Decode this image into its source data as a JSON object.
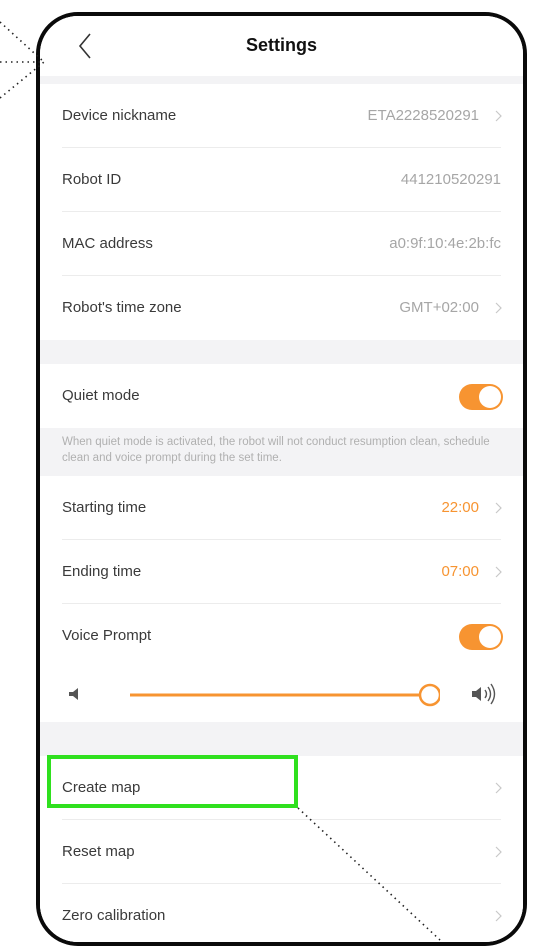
{
  "header": {
    "title": "Settings"
  },
  "device_info": [
    {
      "label": "Device nickname",
      "value": "ETA2228520291",
      "has_chevron": true
    },
    {
      "label": "Robot ID",
      "value": "441210520291",
      "has_chevron": false
    },
    {
      "label": "MAC address",
      "value": "a0:9f:10:4e:2b:fc",
      "has_chevron": false
    },
    {
      "label": "Robot's time zone",
      "value": "GMT+02:00",
      "has_chevron": true
    }
  ],
  "quiet_mode": {
    "label": "Quiet mode",
    "enabled": true,
    "description": "When quiet mode is activated, the robot will not conduct resumption clean, schedule clean and voice prompt during the set time.",
    "starting_time_label": "Starting time",
    "starting_time_value": "22:00",
    "ending_time_label": "Ending time",
    "ending_time_value": "07:00"
  },
  "voice_prompt": {
    "label": "Voice Prompt",
    "enabled": true,
    "volume_level": 1.0
  },
  "map": [
    {
      "label": "Create map"
    },
    {
      "label": "Reset map"
    },
    {
      "label": "Zero calibration"
    }
  ],
  "colors": {
    "accent": "#f79431",
    "highlight": "#2fe01e",
    "background": "#f3f3f5"
  },
  "icons": {
    "back": "chevron-left-icon",
    "row_arrow": "chevron-right-icon",
    "volume_low": "speaker-low-icon",
    "volume_high": "speaker-high-icon"
  }
}
